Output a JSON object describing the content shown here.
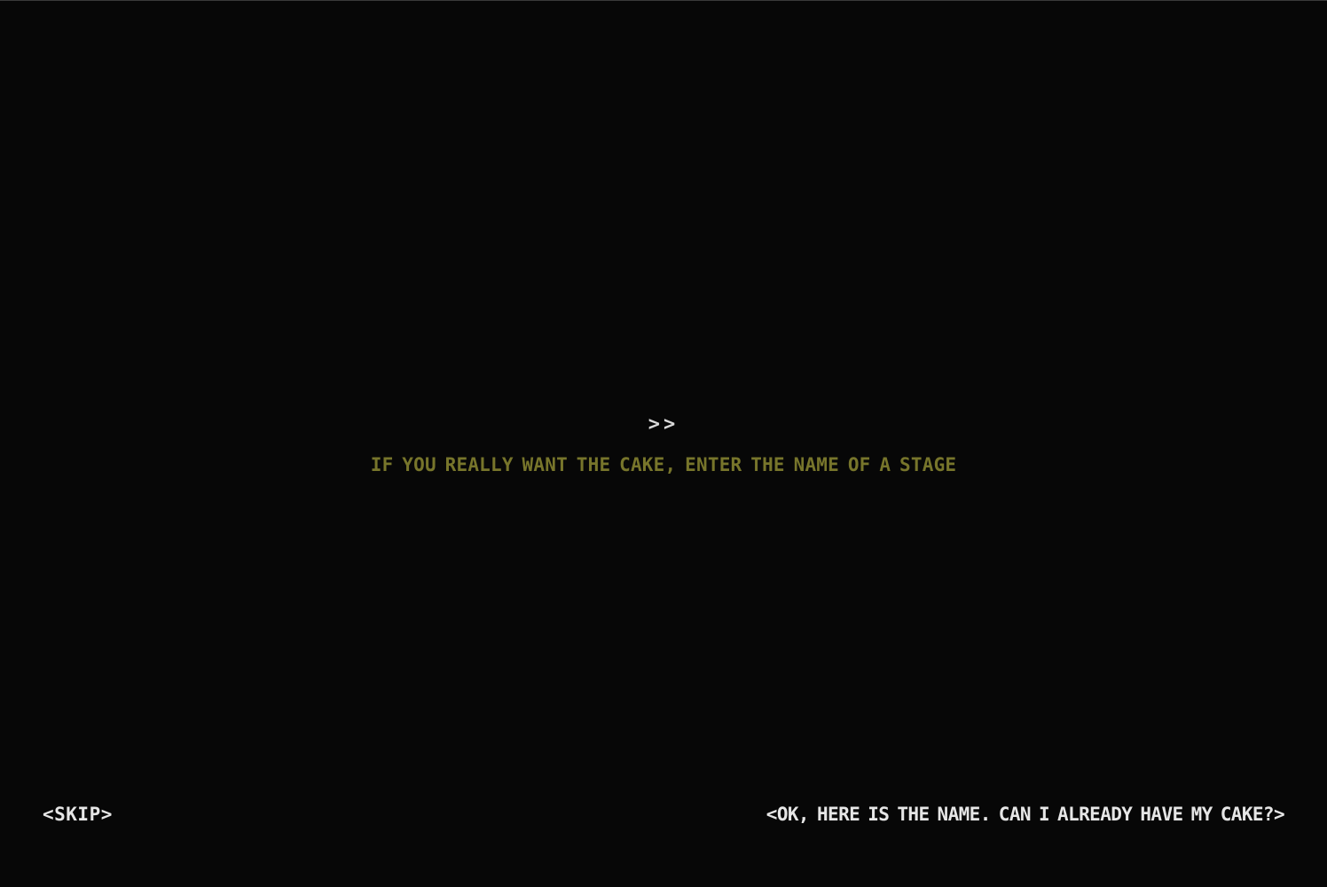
{
  "prompt": {
    "text": ">>"
  },
  "message": {
    "text": "IF YOU REALLY WANT THE CAKE, ENTER THE NAME OF A STAGE"
  },
  "options": {
    "skip_label": "<SKIP>",
    "confirm_label": "<OK, HERE IS THE NAME. CAN I ALREADY HAVE MY CAKE?>"
  },
  "colors": {
    "background": "#070707",
    "prompt": "#d9d9d9",
    "message": "#77752b",
    "options": "#e6e6e6"
  }
}
